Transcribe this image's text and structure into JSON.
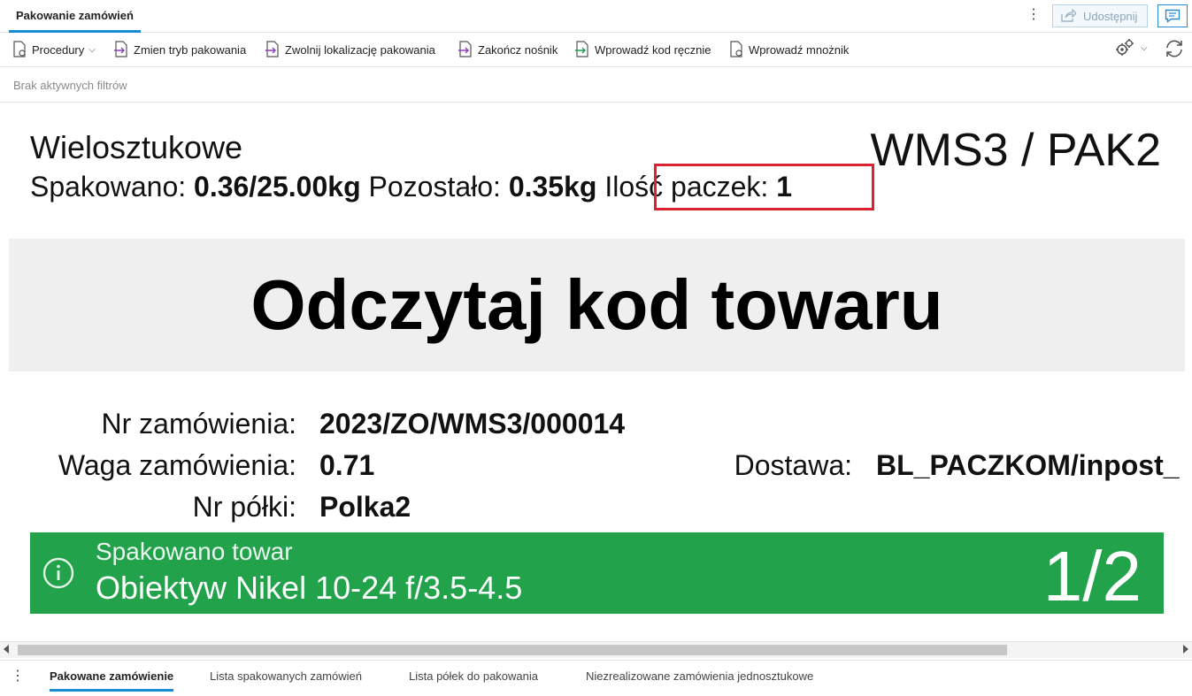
{
  "header": {
    "tab_title": "Pakowanie zamówień",
    "share_label": "Udostępnij"
  },
  "toolbar": {
    "procedures": "Procedury",
    "change_mode": "Zmien tryb pakowania",
    "release_location": "Zwolnij lokalizację pakowania",
    "finish_carrier": "Zakończ nośnik",
    "enter_code": "Wprowadź kod ręcznie",
    "enter_multiplier": "Wprowadź mnożnik"
  },
  "filters": {
    "text": "Brak aktywnych filtrów"
  },
  "status": {
    "mode": "Wielosztukowe",
    "station": "WMS3 / PAK2",
    "packed_label": "Spakowano:",
    "packed_value": "0.36/25.00kg",
    "remaining_label": "Pozostało:",
    "remaining_value": "0.35kg",
    "packages_label": "Ilość paczek:",
    "packages_value": "1"
  },
  "banner": {
    "text": "Odczytaj kod towaru"
  },
  "order": {
    "number_label": "Nr zamówienia:",
    "number_value": "2023/ZO/WMS3/000014",
    "weight_label": "Waga zamówienia:",
    "weight_value": "0.71",
    "delivery_label": "Dostawa:",
    "delivery_value": "BL_PACZKOM/inpost_",
    "shelf_label": "Nr półki:",
    "shelf_value": "Polka2"
  },
  "notice": {
    "title": "Spakowano towar",
    "product": "Obiektyw Nikel 10-24 f/3.5-4.5",
    "count": "1/2",
    "color": "#22a24b"
  },
  "bottom_tabs": [
    {
      "label": "Pakowane zamówienie",
      "active": true
    },
    {
      "label": "Lista spakowanych zamówień",
      "active": false
    },
    {
      "label": "Lista półek do pakowania",
      "active": false
    },
    {
      "label": "Niezrealizowane zamówienia jednosztukowe",
      "active": false
    }
  ],
  "colors": {
    "accent": "#1a8ad4",
    "highlight": "#d9232e",
    "success": "#22a24b"
  }
}
